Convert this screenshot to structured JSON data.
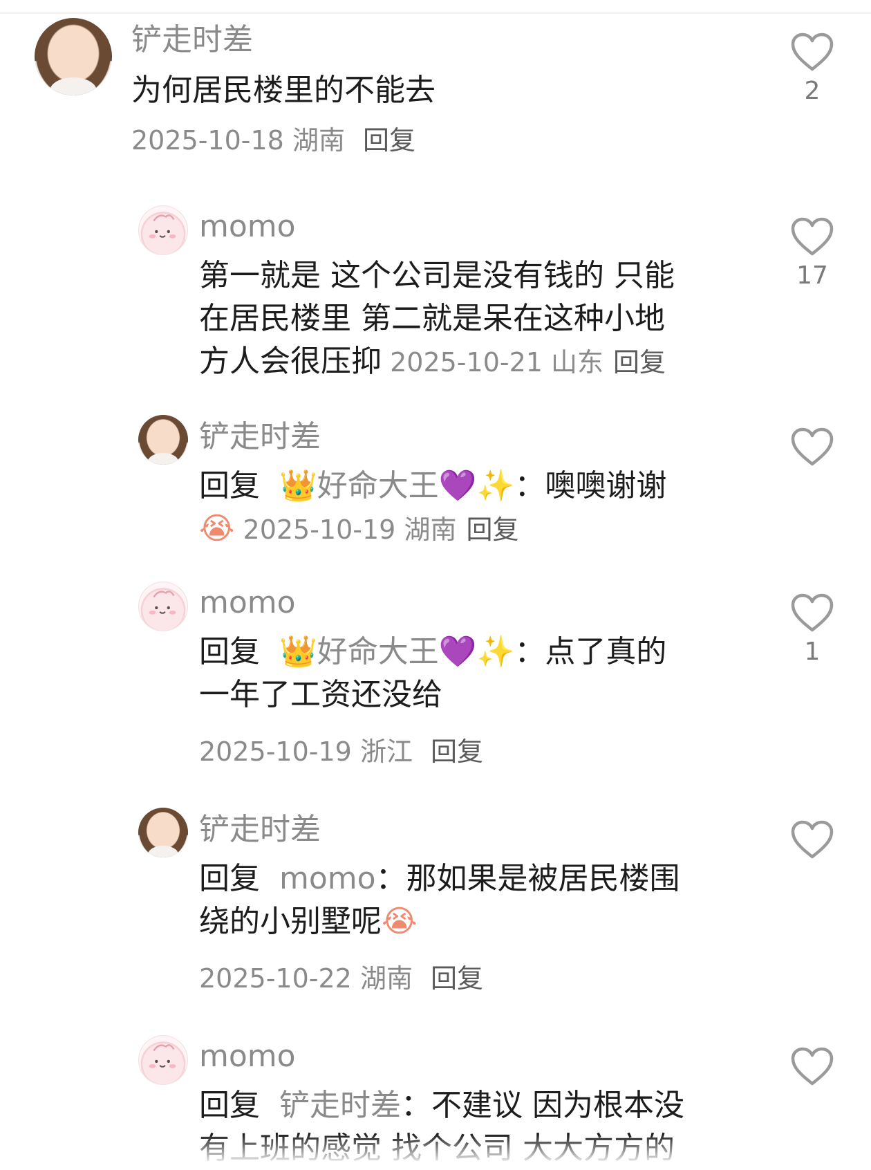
{
  "comments": [
    {
      "username": "铲走时差",
      "text": "为何居民楼里的不能去",
      "date": "2025-10-18",
      "location": "湖南",
      "reply_label": "回复",
      "likes": "2"
    },
    {
      "username": "momo",
      "text_lines": [
        "第一就是 这个公司是没有钱的 只能",
        "在居民楼里 第二就是呆在这种小地",
        "方人会很压抑"
      ],
      "date": "2025-10-21",
      "location": "山东",
      "reply_label": "回复",
      "likes": "17"
    },
    {
      "username": "铲走时差",
      "reply_prefix": "回复",
      "reply_to": "👑好命大王💜✨",
      "text": "噢噢谢谢",
      "emoji": "😭",
      "date": "2025-10-19",
      "location": "湖南",
      "reply_label": "回复",
      "likes": ""
    },
    {
      "username": "momo",
      "reply_prefix": "回复",
      "reply_to": "👑好命大王💜✨",
      "text": "点了真的",
      "text_line2": "一年了工资还没给",
      "date": "2025-10-19",
      "location": "浙江",
      "reply_label": "回复",
      "likes": "1"
    },
    {
      "username": "铲走时差",
      "reply_prefix": "回复",
      "reply_to": "momo",
      "text": "那如果是被居民楼围",
      "text_line2": "绕的小别墅呢",
      "emoji": "😭",
      "date": "2025-10-22",
      "location": "湖南",
      "reply_label": "回复",
      "likes": ""
    },
    {
      "username": "momo",
      "reply_prefix": "回复",
      "reply_to": "铲走时差",
      "text": "不建议 因为根本没",
      "text_line2": "有上班的感觉 找个公司 大大方方的",
      "likes": ""
    }
  ],
  "separator": "："
}
